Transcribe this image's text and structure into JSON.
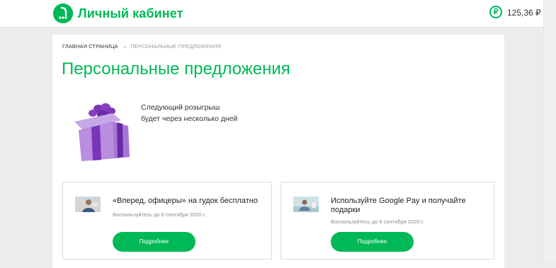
{
  "header": {
    "title": "Личный кабинет",
    "logo_icon": "megafon-logo-icon",
    "balance_icon": "ruble-icon",
    "balance_symbol": "₽",
    "balance": "125,36 ₽"
  },
  "breadcrumb": {
    "home": "ГЛАВНАЯ СТРАНИЦА",
    "separator": "→",
    "current": "ПЕРСОНАЛЬНЫЕ ПРЕДЛОЖЕНИЯ"
  },
  "page": {
    "title": "Персональные предложения",
    "gift_icon": "gift-box-icon",
    "draw_line1": "Следующий розыгрыш",
    "draw_line2": "будет через несколько дней"
  },
  "offers": [
    {
      "title": "«Вперед, офицеры» на гудок бесплатно",
      "subtitle": "Воспользуйтесь до 6 сентября 2020 г.",
      "button": "Подробнее"
    },
    {
      "title": "Используйте Google Pay и получайте подарки",
      "subtitle": "Воспользуйтесь до 6 сентября 2020 г.",
      "button": "Подробнее"
    }
  ],
  "colors": {
    "brand": "#00b956",
    "gift": "#8a3fbf",
    "background": "#ececec"
  }
}
